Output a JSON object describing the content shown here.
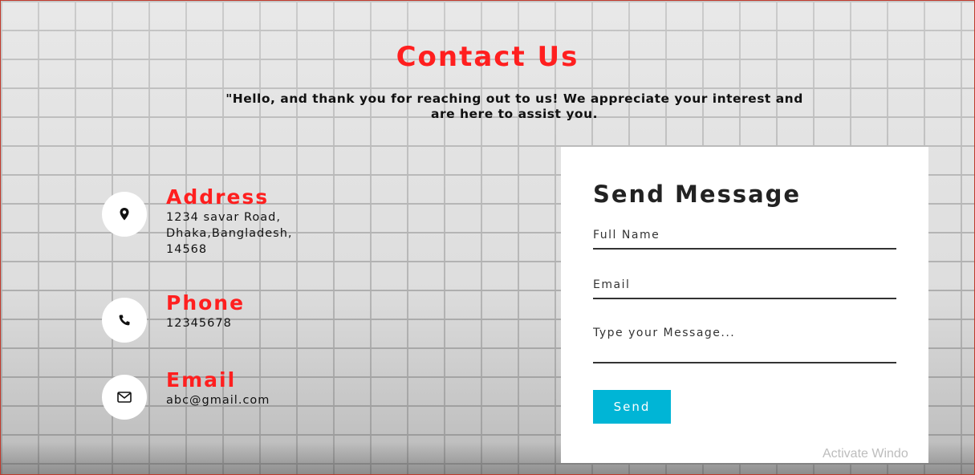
{
  "header": {
    "title": "Contact Us",
    "subtitle": "\"Hello, and thank you for reaching out to us! We appreciate your interest and are here to assist you."
  },
  "contact_info": {
    "address": {
      "label": "Address",
      "value": "1234 savar Road,\nDhaka,Bangladesh,\n14568",
      "icon": "map-pin-icon"
    },
    "phone": {
      "label": "Phone",
      "value": "12345678",
      "icon": "phone-icon"
    },
    "email": {
      "label": "Email",
      "value": "abc@gmail.com",
      "icon": "envelope-icon"
    }
  },
  "form": {
    "title": "Send Message",
    "full_name_placeholder": "Full Name",
    "email_placeholder": "Email",
    "message_placeholder": "Type your Message...",
    "send_label": "Send"
  },
  "watermark": "Activate Windo",
  "colors": {
    "accent_red": "#ff1f1f",
    "button_blue": "#00b5d6",
    "card_bg": "#ffffff",
    "text_dark": "#111111"
  }
}
